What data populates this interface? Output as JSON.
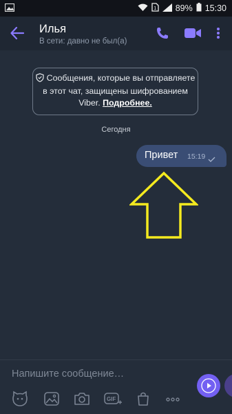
{
  "status_bar": {
    "battery": "89%",
    "time": "15:30"
  },
  "header": {
    "title": "Илья",
    "subtitle": "В сети: давно не был(а)"
  },
  "notice": {
    "text": "Сообщения, которые вы отправляете в этот чат, защищены шифрованием Viber.",
    "more_link": "Подробнее."
  },
  "date_separator": "Сегодня",
  "message": {
    "text": "Привет",
    "time": "15:19"
  },
  "composer": {
    "placeholder": "Напишите сообщение…",
    "tools": [
      "sticker-icon",
      "gallery-icon",
      "camera-icon",
      "gif-icon",
      "bag-icon",
      "more-icon"
    ]
  },
  "colors": {
    "background": "#242d3a",
    "accent": "#7360f2",
    "bubble": "#3a4d74",
    "annotation_arrow": "#f4ea1f"
  }
}
